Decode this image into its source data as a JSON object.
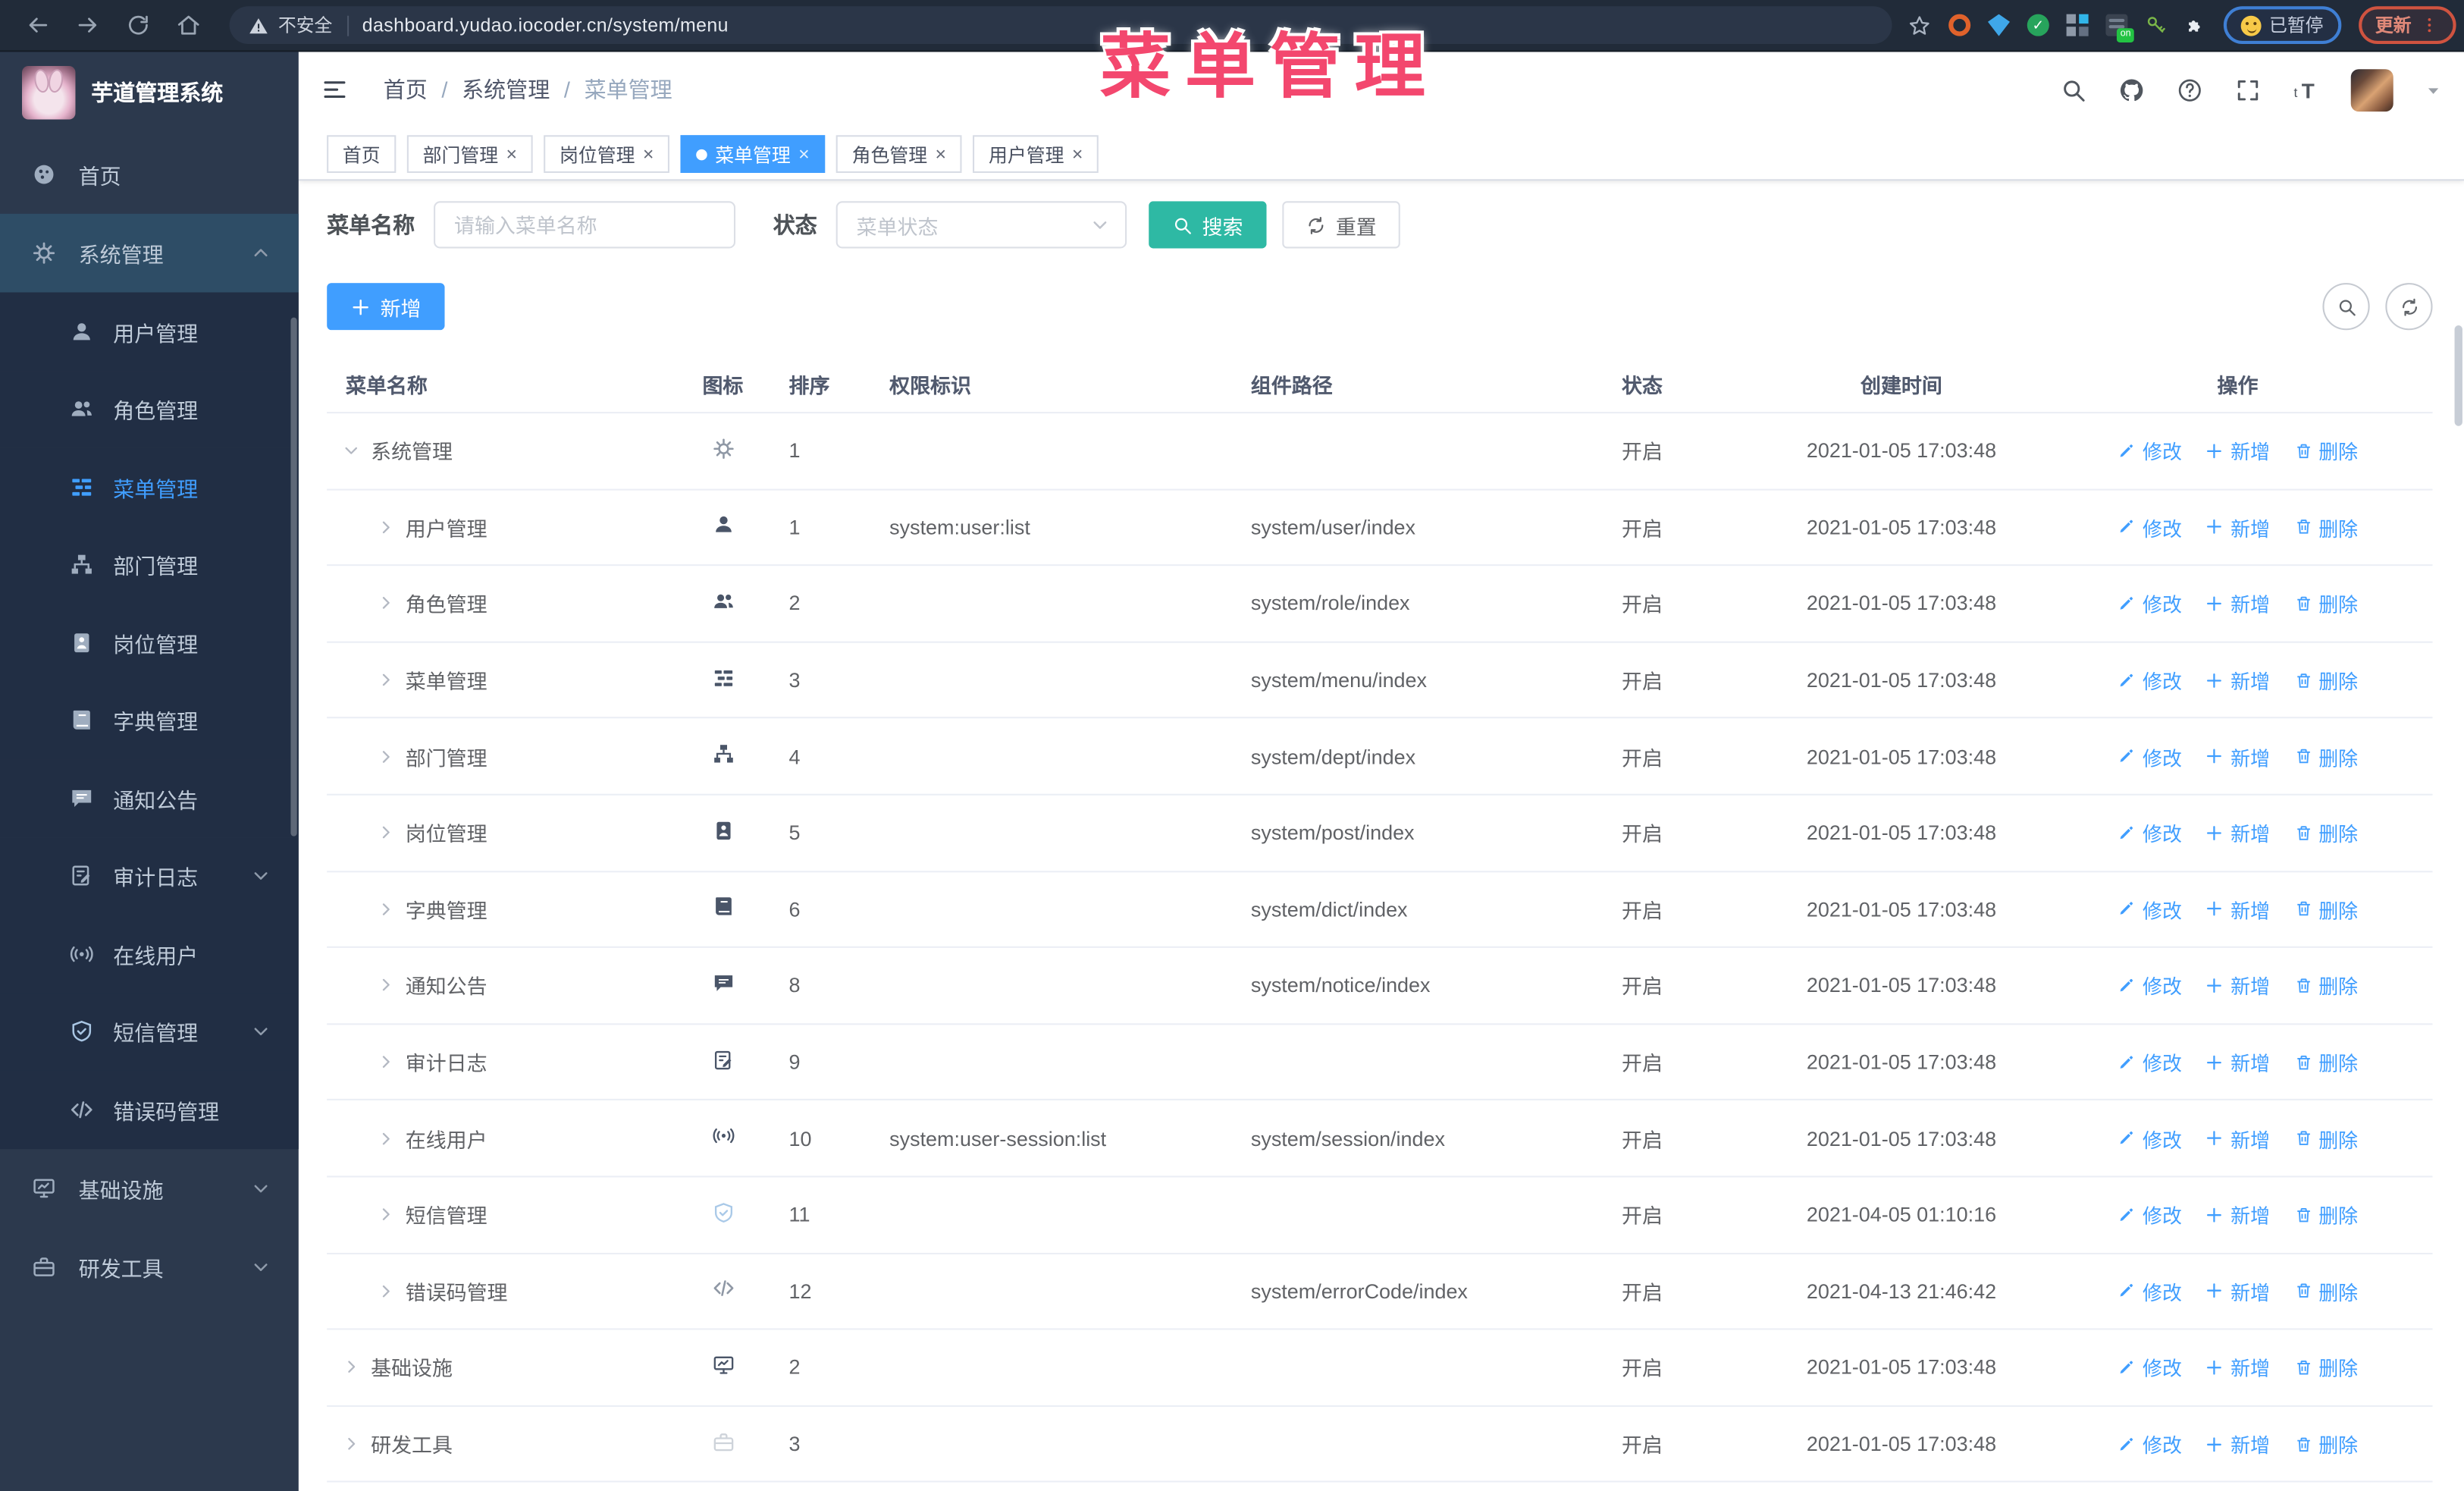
{
  "browser": {
    "security_label": "不安全",
    "url": "dashboard.yudao.iocoder.cn/system/menu",
    "paused_label": "已暂停",
    "update_label": "更新"
  },
  "overlay_title": "菜单管理",
  "sidebar": {
    "title": "芋道管理系统",
    "items": [
      {
        "label": "首页",
        "icon": "dashboard",
        "type": "root"
      },
      {
        "label": "系统管理",
        "icon": "gear",
        "type": "root",
        "highlight": true,
        "arrow": "up"
      },
      {
        "label": "用户管理",
        "icon": "user",
        "type": "sub"
      },
      {
        "label": "角色管理",
        "icon": "peoples",
        "type": "sub"
      },
      {
        "label": "菜单管理",
        "icon": "tree-table",
        "type": "sub",
        "active": true
      },
      {
        "label": "部门管理",
        "icon": "tree",
        "type": "sub"
      },
      {
        "label": "岗位管理",
        "icon": "post",
        "type": "sub"
      },
      {
        "label": "字典管理",
        "icon": "dict",
        "type": "sub"
      },
      {
        "label": "通知公告",
        "icon": "message",
        "type": "sub"
      },
      {
        "label": "审计日志",
        "icon": "log",
        "type": "sub",
        "arrow": "down"
      },
      {
        "label": "在线用户",
        "icon": "online",
        "type": "sub"
      },
      {
        "label": "短信管理",
        "icon": "sms",
        "type": "sub",
        "arrow": "down"
      },
      {
        "label": "错误码管理",
        "icon": "code",
        "type": "sub"
      },
      {
        "label": "基础设施",
        "icon": "monitor",
        "type": "root",
        "arrow": "down"
      },
      {
        "label": "研发工具",
        "icon": "tool",
        "type": "root",
        "arrow": "down"
      }
    ]
  },
  "header": {
    "breadcrumbs": [
      "首页",
      "系统管理",
      "菜单管理"
    ]
  },
  "tabs": [
    {
      "label": "首页",
      "closable": false,
      "active": false
    },
    {
      "label": "部门管理",
      "closable": true,
      "active": false
    },
    {
      "label": "岗位管理",
      "closable": true,
      "active": false
    },
    {
      "label": "菜单管理",
      "closable": true,
      "active": true
    },
    {
      "label": "角色管理",
      "closable": true,
      "active": false
    },
    {
      "label": "用户管理",
      "closable": true,
      "active": false
    }
  ],
  "filter": {
    "name_label": "菜单名称",
    "name_placeholder": "请输入菜单名称",
    "status_label": "状态",
    "status_placeholder": "菜单状态",
    "search_label": "搜索",
    "reset_label": "重置"
  },
  "toolbar": {
    "add_label": "新增"
  },
  "table": {
    "columns": [
      "菜单名称",
      "图标",
      "排序",
      "权限标识",
      "组件路径",
      "状态",
      "创建时间",
      "操作"
    ],
    "action_labels": [
      "修改",
      "新增",
      "删除"
    ],
    "rows": [
      {
        "name": "系统管理",
        "icon": "gear",
        "level": 0,
        "caret": "down",
        "sort": "1",
        "perm": "",
        "path": "",
        "status": "开启",
        "time": "2021-01-05 17:03:48"
      },
      {
        "name": "用户管理",
        "icon": "user",
        "level": 1,
        "caret": "right",
        "sort": "1",
        "perm": "system:user:list",
        "path": "system/user/index",
        "status": "开启",
        "time": "2021-01-05 17:03:48"
      },
      {
        "name": "角色管理",
        "icon": "peoples",
        "level": 1,
        "caret": "right",
        "sort": "2",
        "perm": "",
        "path": "system/role/index",
        "status": "开启",
        "time": "2021-01-05 17:03:48"
      },
      {
        "name": "菜单管理",
        "icon": "tree-table",
        "level": 1,
        "caret": "right",
        "sort": "3",
        "perm": "",
        "path": "system/menu/index",
        "status": "开启",
        "time": "2021-01-05 17:03:48"
      },
      {
        "name": "部门管理",
        "icon": "tree",
        "level": 1,
        "caret": "right",
        "sort": "4",
        "perm": "",
        "path": "system/dept/index",
        "status": "开启",
        "time": "2021-01-05 17:03:48"
      },
      {
        "name": "岗位管理",
        "icon": "post",
        "level": 1,
        "caret": "right",
        "sort": "5",
        "perm": "",
        "path": "system/post/index",
        "status": "开启",
        "time": "2021-01-05 17:03:48"
      },
      {
        "name": "字典管理",
        "icon": "dict",
        "level": 1,
        "caret": "right",
        "sort": "6",
        "perm": "",
        "path": "system/dict/index",
        "status": "开启",
        "time": "2021-01-05 17:03:48"
      },
      {
        "name": "通知公告",
        "icon": "message",
        "level": 1,
        "caret": "right",
        "sort": "8",
        "perm": "",
        "path": "system/notice/index",
        "status": "开启",
        "time": "2021-01-05 17:03:48"
      },
      {
        "name": "审计日志",
        "icon": "log",
        "level": 1,
        "caret": "right",
        "sort": "9",
        "perm": "",
        "path": "",
        "status": "开启",
        "time": "2021-01-05 17:03:48"
      },
      {
        "name": "在线用户",
        "icon": "online",
        "level": 1,
        "caret": "right",
        "sort": "10",
        "perm": "system:user-session:list",
        "path": "system/session/index",
        "status": "开启",
        "time": "2021-01-05 17:03:48"
      },
      {
        "name": "短信管理",
        "icon": "sms",
        "level": 1,
        "caret": "right",
        "sort": "11",
        "perm": "",
        "path": "",
        "status": "开启",
        "time": "2021-04-05 01:10:16"
      },
      {
        "name": "错误码管理",
        "icon": "code",
        "level": 1,
        "caret": "right",
        "sort": "12",
        "perm": "",
        "path": "system/errorCode/index",
        "status": "开启",
        "time": "2021-04-13 21:46:42"
      },
      {
        "name": "基础设施",
        "icon": "monitor",
        "level": 0,
        "caret": "right",
        "sort": "2",
        "perm": "",
        "path": "",
        "status": "开启",
        "time": "2021-01-05 17:03:48"
      },
      {
        "name": "研发工具",
        "icon": "tool",
        "level": 0,
        "caret": "right",
        "sort": "3",
        "perm": "",
        "path": "",
        "status": "开启",
        "time": "2021-01-05 17:03:48"
      }
    ]
  },
  "colors": {
    "primary": "#409eff",
    "teal": "#2eb9a4",
    "sidebar_bg": "#2c394d",
    "submenu_bg": "#212e44",
    "overlay_pink": "#f3476e"
  }
}
